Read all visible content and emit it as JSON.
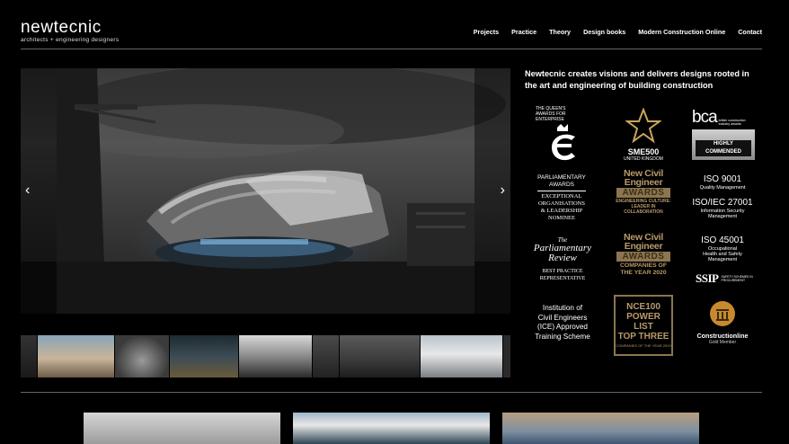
{
  "brand": {
    "name": "newtecnic",
    "tagline": "architects + engineering designers"
  },
  "nav": [
    {
      "label": "Projects"
    },
    {
      "label": "Practice"
    },
    {
      "label": "Theory"
    },
    {
      "label": "Design books"
    },
    {
      "label": "Modern Construction Online"
    },
    {
      "label": "Contact"
    }
  ],
  "hero": {
    "prev_icon": "chevron-left-icon",
    "next_icon": "chevron-right-icon"
  },
  "intro": "Newtecnic creates visions and delivers designs rooted in the art and engineering of building construction",
  "awards": {
    "queens": {
      "header": "THE QUEEN'S AWARDS FOR ENTERPRISE",
      "line1": "PARLIAMENTARY",
      "line2": "AWARDS",
      "line3": "EXCEPTIONAL",
      "line4": "ORGANISATIONS",
      "line5": "& LEADERSHIP",
      "line6": "NOMINEE"
    },
    "sme": {
      "title": "SME500",
      "sub": "UNITED KINGDOM"
    },
    "nce1": {
      "l1": "New Civil",
      "l2": "Engineer",
      "banner": "AWARDS",
      "c1": "ENGINEERING CULTURE:",
      "c2": "LEADER IN",
      "c3": "COLLABORATION"
    },
    "nce2": {
      "l1": "New Civil",
      "l2": "Engineer",
      "banner": "AWARDS",
      "c1": "COMPANIES OF",
      "c2": "THE YEAR 2020"
    },
    "bca": {
      "logo": "bca",
      "small1": "british construction",
      "small2": "industry awards",
      "badge": "HIGHLY COMMENDED"
    },
    "iso1": {
      "title": "ISO 9001",
      "sub": "Quality Management"
    },
    "iso2": {
      "title": "ISO/IEC 27001",
      "sub1": "Information Security",
      "sub2": "Management"
    },
    "iso3": {
      "title": "ISO 45001",
      "sub1": "Occupational",
      "sub2": "Health and Safety",
      "sub3": "Management"
    },
    "ssip": {
      "logo": "SSIP",
      "small1": "SAFETY SCHEMES IN",
      "small2": "PROCUREMENT"
    },
    "review": {
      "l1": "The",
      "l2": "Parliamentary",
      "l3": "Review",
      "c1": "BEST PRACTICE",
      "c2": "REPRESENTATIVE"
    },
    "ice": {
      "l1": "Institution of",
      "l2": "Civil Engineers",
      "l3": "(ICE) Approved",
      "l4": "Training Scheme"
    },
    "power": {
      "l1": "NCE100",
      "l2": "POWER LIST",
      "l3": "TOP THREE",
      "l4": "COMPANIES OF THE YEAR 2019"
    },
    "constructionline": {
      "name": "Constructionline",
      "sub": "Gold Member"
    }
  }
}
